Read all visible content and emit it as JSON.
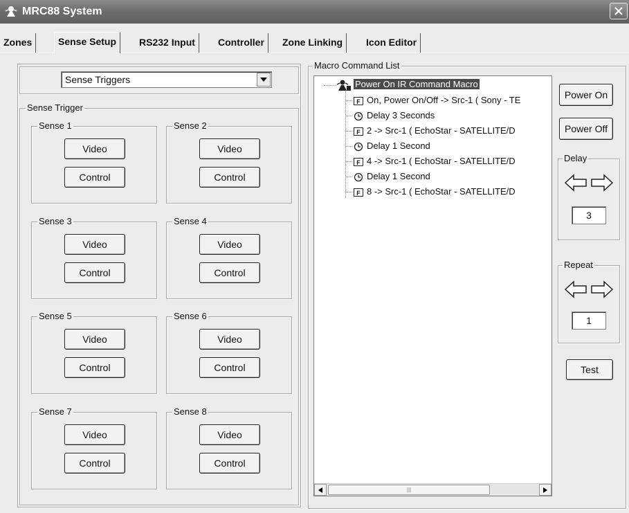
{
  "window": {
    "title": "MRC88 System"
  },
  "tabs": [
    {
      "label": "Zones",
      "active": false
    },
    {
      "label": "Sense Setup",
      "active": true
    },
    {
      "label": "RS232 Input",
      "active": false
    },
    {
      "label": "Controller",
      "active": false
    },
    {
      "label": "Zone Linking",
      "active": false
    },
    {
      "label": "Icon Editor",
      "active": false
    }
  ],
  "trigger_select": {
    "value": "Sense Triggers"
  },
  "sense_trigger": {
    "title": "Sense Trigger",
    "groups": [
      {
        "label": "Sense 1",
        "video": "Video",
        "control": "Control"
      },
      {
        "label": "Sense 2",
        "video": "Video",
        "control": "Control"
      },
      {
        "label": "Sense 3",
        "video": "Video",
        "control": "Control"
      },
      {
        "label": "Sense 4",
        "video": "Video",
        "control": "Control"
      },
      {
        "label": "Sense 5",
        "video": "Video",
        "control": "Control"
      },
      {
        "label": "Sense 6",
        "video": "Video",
        "control": "Control"
      },
      {
        "label": "Sense 7",
        "video": "Video",
        "control": "Control"
      },
      {
        "label": "Sense 8",
        "video": "Video",
        "control": "Control"
      }
    ]
  },
  "macro": {
    "title": "Macro Command List",
    "root": "Power On IR Command Macro",
    "items": [
      {
        "icon": "function-icon",
        "text": "On, Power On/Off -> Src-1 ( Sony - TE"
      },
      {
        "icon": "clock-icon",
        "text": "Delay 3 Seconds"
      },
      {
        "icon": "function-icon",
        "text": "2 -> Src-1 ( EchoStar - SATELLITE/D"
      },
      {
        "icon": "clock-icon",
        "text": "Delay 1 Second"
      },
      {
        "icon": "function-icon",
        "text": "4 -> Src-1 ( EchoStar - SATELLITE/D"
      },
      {
        "icon": "clock-icon",
        "text": "Delay 1 Second"
      },
      {
        "icon": "function-icon",
        "text": "8 -> Src-1 ( EchoStar - SATELLITE/D"
      }
    ]
  },
  "side": {
    "power_on": "Power On",
    "power_off": "Power Off",
    "delay": {
      "label": "Delay",
      "value": "3"
    },
    "repeat": {
      "label": "Repeat",
      "value": "1"
    },
    "test": "Test"
  }
}
